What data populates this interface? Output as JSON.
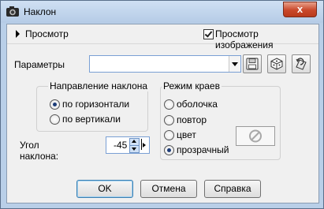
{
  "window": {
    "title": "Наклон",
    "close_label": "x",
    "accent_color": "#c9482a"
  },
  "preview": {
    "toggle_label": "Просмотр",
    "checkbox_label": "Просмотр изображения",
    "checkbox_checked": true
  },
  "params": {
    "label": "Параметры",
    "value": "",
    "buttons": [
      {
        "name": "save-preset-button",
        "icon": "floppy-disk-icon"
      },
      {
        "name": "randomize-button",
        "icon": "dice-icon"
      },
      {
        "name": "reset-button",
        "icon": "reset-icon"
      }
    ]
  },
  "direction": {
    "title": "Направление наклона",
    "options": [
      {
        "label": "по горизонтали",
        "selected": true
      },
      {
        "label": "по вертикали",
        "selected": false
      }
    ]
  },
  "angle": {
    "label_line1": "Угол",
    "label_line2": "наклона:",
    "value": "-45"
  },
  "edge_mode": {
    "title": "Режим краев",
    "options": [
      {
        "label": "оболочка",
        "selected": false
      },
      {
        "label": "повтор",
        "selected": false
      },
      {
        "label": "цвет",
        "selected": false
      },
      {
        "label": "прозрачный",
        "selected": true
      }
    ],
    "swatch_icon": "no-color-icon"
  },
  "buttons": {
    "ok": "OK",
    "cancel": "Отмена",
    "help": "Справка"
  }
}
